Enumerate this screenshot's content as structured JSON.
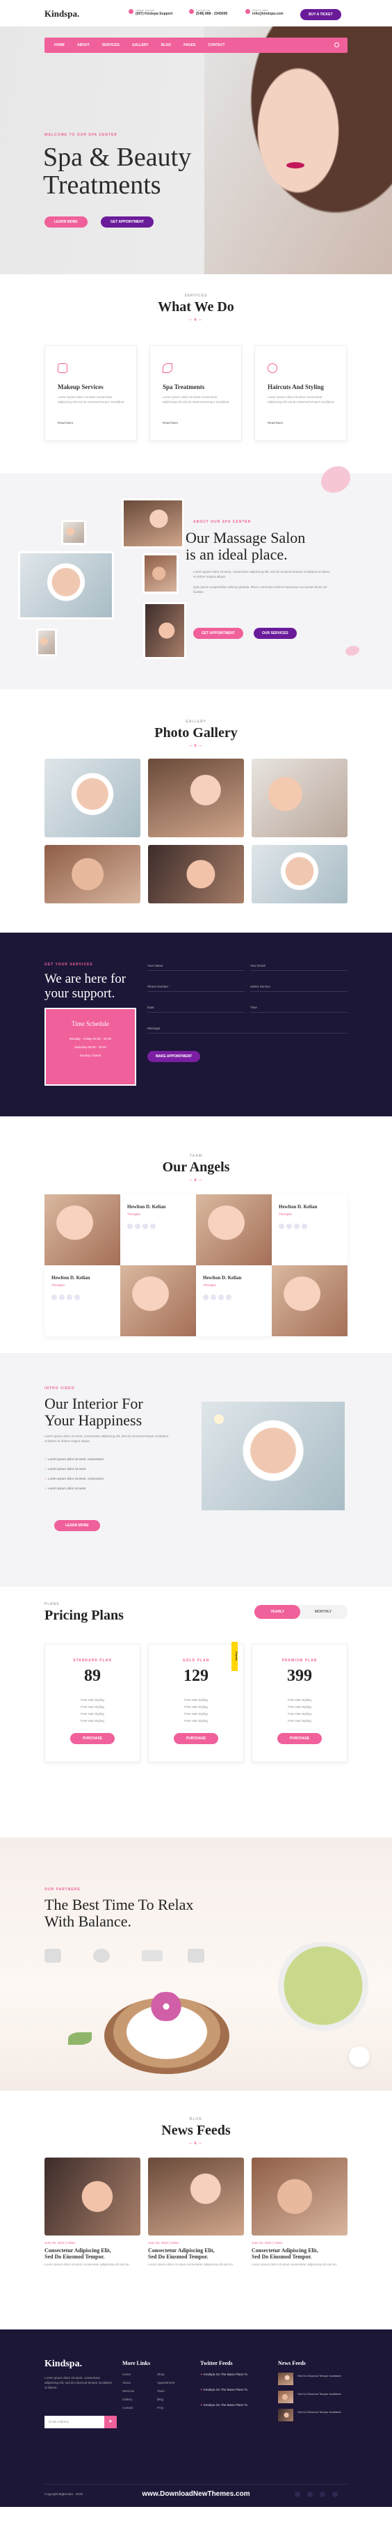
{
  "brand": "Kindspa.",
  "topbar": {
    "support_label": "Hotline Support",
    "support_value": "(007) Kindspa Support",
    "contact_label": "Contact Us",
    "contact_value": "(548) 888 - 2345695",
    "email_label": "Send E-Mail",
    "email_value": "info@kindspa.com",
    "cta": "Buy A Ticket"
  },
  "nav": {
    "items": [
      "Home",
      "About",
      "Services",
      "Gallery",
      "Blog",
      "Pages",
      "Contact"
    ]
  },
  "hero": {
    "eyebrow": "Welcome To Our Spa Center",
    "title_line1": "Spa & Beauty",
    "title_line2": "Treatments",
    "btn1": "Learn More",
    "btn2": "Get Appointment"
  },
  "services": {
    "eyebrow": "Services",
    "title": "What We Do",
    "items": [
      {
        "icon": "lipstick-icon",
        "title": "Makeup Services",
        "text": "Lorem ipsum dolor sit amet consectetur adipiscing elit sed do eiusmod tempor incididunt.",
        "link": "Read More"
      },
      {
        "icon": "spa-leaf-icon",
        "title": "Spa Treatments",
        "text": "Lorem ipsum dolor sit amet consectetur adipiscing elit sed do eiusmod tempor incididunt.",
        "link": "Read More"
      },
      {
        "icon": "scissors-icon",
        "title": "Haircuts And Styling",
        "text": "Lorem ipsum dolor sit amet consectetur adipiscing elit sed do eiusmod tempor incididunt.",
        "link": "Read More"
      }
    ]
  },
  "massage": {
    "eyebrow": "About Our Spa Center",
    "title_line1": "Our Massage Salon",
    "title_line2": "is an ideal place.",
    "text1": "Lorem ipsum dolor sit amet, consectetur adipiscing elit, sed do eiusmod tempor incididunt ut labore et dolore magna aliqua.",
    "text2": "Quis ipsum suspendisse ultrices gravida. Risus commodo viverra maecenas accumsan lacus vel facilisis.",
    "btn1": "Get Appointment",
    "btn2": "Our Services"
  },
  "gallery": {
    "eyebrow": "Gallery",
    "title": "Photo Gallery"
  },
  "support": {
    "eyebrow": "Get Your Services",
    "title_line1": "We are here for",
    "title_line2": "your support.",
    "schedule_title": "Time Schedule",
    "schedule_lines": [
      "Monday - Friday 09.00 - 20.00",
      "Saturday 09.00 - 18.00",
      "Sunday Closed"
    ],
    "fields": [
      "Your Name",
      "Your Email",
      "Phone Number",
      "Select Service",
      "Date",
      "Time",
      "Message"
    ],
    "submit": "Make Appointment"
  },
  "team": {
    "eyebrow": "Team",
    "title": "Our Angels",
    "members": [
      {
        "name": "Hewlton D. Kelian",
        "role": "Therapist"
      },
      {
        "name": "Hewlton D. Kelian",
        "role": "Therapist"
      },
      {
        "name": "Hewlton D. Kelian",
        "role": "Therapist"
      },
      {
        "name": "Hewlton D. Kelian",
        "role": "Therapist"
      }
    ]
  },
  "interior": {
    "eyebrow": "Intro Video",
    "title_line1": "Our Interior For",
    "title_line2": "Your Happiness",
    "text": "Lorem ipsum dolor sit amet, consectetur adipiscing elit, sed do eiusmod tempor incididunt ut labore et dolore magna aliqua.",
    "bullets": [
      "Lorem ipsum dolor sit amet, consectetur",
      "Lorem ipsum dolor sit amet",
      "Lorem ipsum dolor sit amet, consectetur",
      "Lorem ipsum dolor sit amet"
    ],
    "btn": "Learn More"
  },
  "pricing": {
    "eyebrow": "Plans",
    "title": "Pricing Plans",
    "toggle_yearly": "Yearly",
    "toggle_monthly": "Monthly",
    "plans": [
      {
        "name": "Standard Plan",
        "price": "89",
        "features": [
          "Free Hair Styling",
          "Free Hair Styling",
          "Free Hair Styling",
          "Free Hair Styling"
        ],
        "btn": "Purchase"
      },
      {
        "name": "Gold Plan",
        "price": "129",
        "badge": "Popular",
        "features": [
          "Free Hair Styling",
          "Free Hair Styling",
          "Free Hair Styling",
          "Free Hair Styling"
        ],
        "btn": "Purchase"
      },
      {
        "name": "Premium Plan",
        "price": "399",
        "features": [
          "Free Hair Styling",
          "Free Hair Styling",
          "Free Hair Styling",
          "Free Hair Styling"
        ],
        "btn": "Purchase"
      }
    ]
  },
  "relax": {
    "eyebrow": "Our Partners",
    "title_line1": "The Best Time To Relax",
    "title_line2": "With Balance."
  },
  "news": {
    "eyebrow": "Blog",
    "title": "News Feeds",
    "posts": [
      {
        "meta": "June 25, 2019  |  Admin",
        "title_line1": "Consectetur Adipiscing Elit,",
        "title_line2": "Sed Do Eiusmod Tempor.",
        "text": "Lorem ipsum dolor sit amet consectetur adipiscing elit sed do."
      },
      {
        "meta": "June 25, 2019  |  Admin",
        "title_line1": "Consectetur Adipiscing Elit,",
        "title_line2": "Sed Do Eiusmod Tempor.",
        "text": "Lorem ipsum dolor sit amet consectetur adipiscing elit sed do."
      },
      {
        "meta": "June 25, 2019  |  Admin",
        "title_line1": "Consectetur Adipiscing Elit,",
        "title_line2": "Sed Do Eiusmod Tempor.",
        "text": "Lorem ipsum dolor sit amet consectetur adipiscing elit sed do."
      }
    ]
  },
  "footer": {
    "brand": "Kindspa.",
    "about": "Lorem ipsum dolor sit amet, consectetur adipiscing elit, sed do eiusmod tempor incididunt ut labore.",
    "email_placeholder": "Email Address",
    "links_title": "More Links",
    "links_col1": [
      "Home",
      "About",
      "Services",
      "Gallery",
      "Contact"
    ],
    "links_col2": [
      "Shop",
      "Appointment",
      "Team",
      "Blog",
      "FAQ"
    ],
    "twitter_title": "Twitter Feeds",
    "tweets": [
      "Kindspa On The Basis Plans To",
      "Kindspa On The Basis Plans To",
      "Kindspa On The Basis Plans To"
    ],
    "news_title": "News Feeds",
    "news_items": [
      "Sed Do Eiusmod Tempor Incididunt",
      "Sed Do Eiusmod Tempor Incididunt",
      "Sed Do Eiusmod Tempor Incididunt"
    ],
    "copyright": "Copyright BigEnvato - 2019",
    "watermark": "www.DownloadNewThemes.com"
  },
  "colors": {
    "accent": "#f0609a",
    "purple": "#6a1b9a",
    "dark": "#1c1637"
  }
}
